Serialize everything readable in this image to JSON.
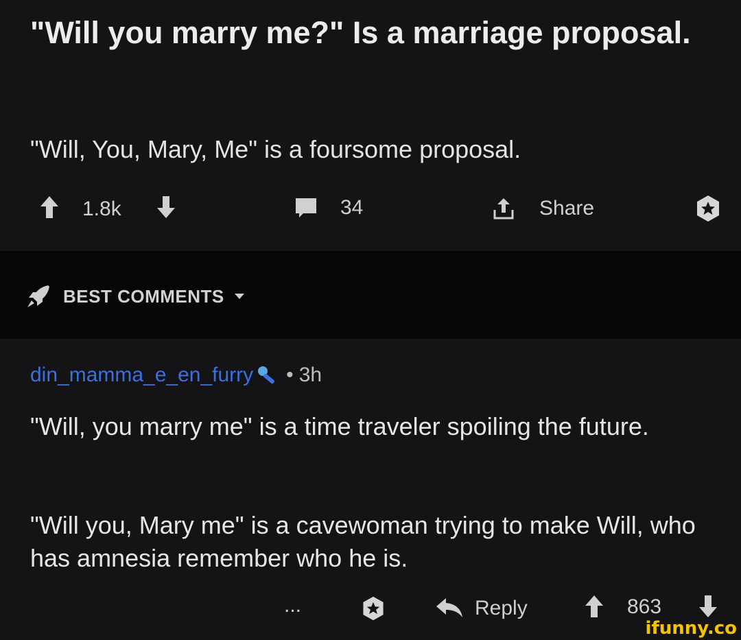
{
  "post": {
    "title": "\"Will you marry me?\" Is a marriage proposal.",
    "body": "\"Will, You, Mary, Me\" is a foursome proposal.",
    "upvotes": "1.8k",
    "comments": "34",
    "share_label": "Share"
  },
  "section": {
    "sort_label": "BEST COMMENTS"
  },
  "comment": {
    "username": "din_mamma_e_en_furry",
    "separator": "•",
    "time": "3h",
    "paragraphs": [
      "\"Will, you marry me\" is a time traveler spoiling the future.",
      "\"Will you, Mary me\" is a cavewoman trying to make Will, who has amnesia remember who he is."
    ],
    "more": "...",
    "reply_label": "Reply",
    "score": "863"
  },
  "watermark": "ifunny.co",
  "colors": {
    "background": "#141416",
    "band": "#070708",
    "username": "#3c6fe0",
    "watermark": "#f5c400"
  }
}
